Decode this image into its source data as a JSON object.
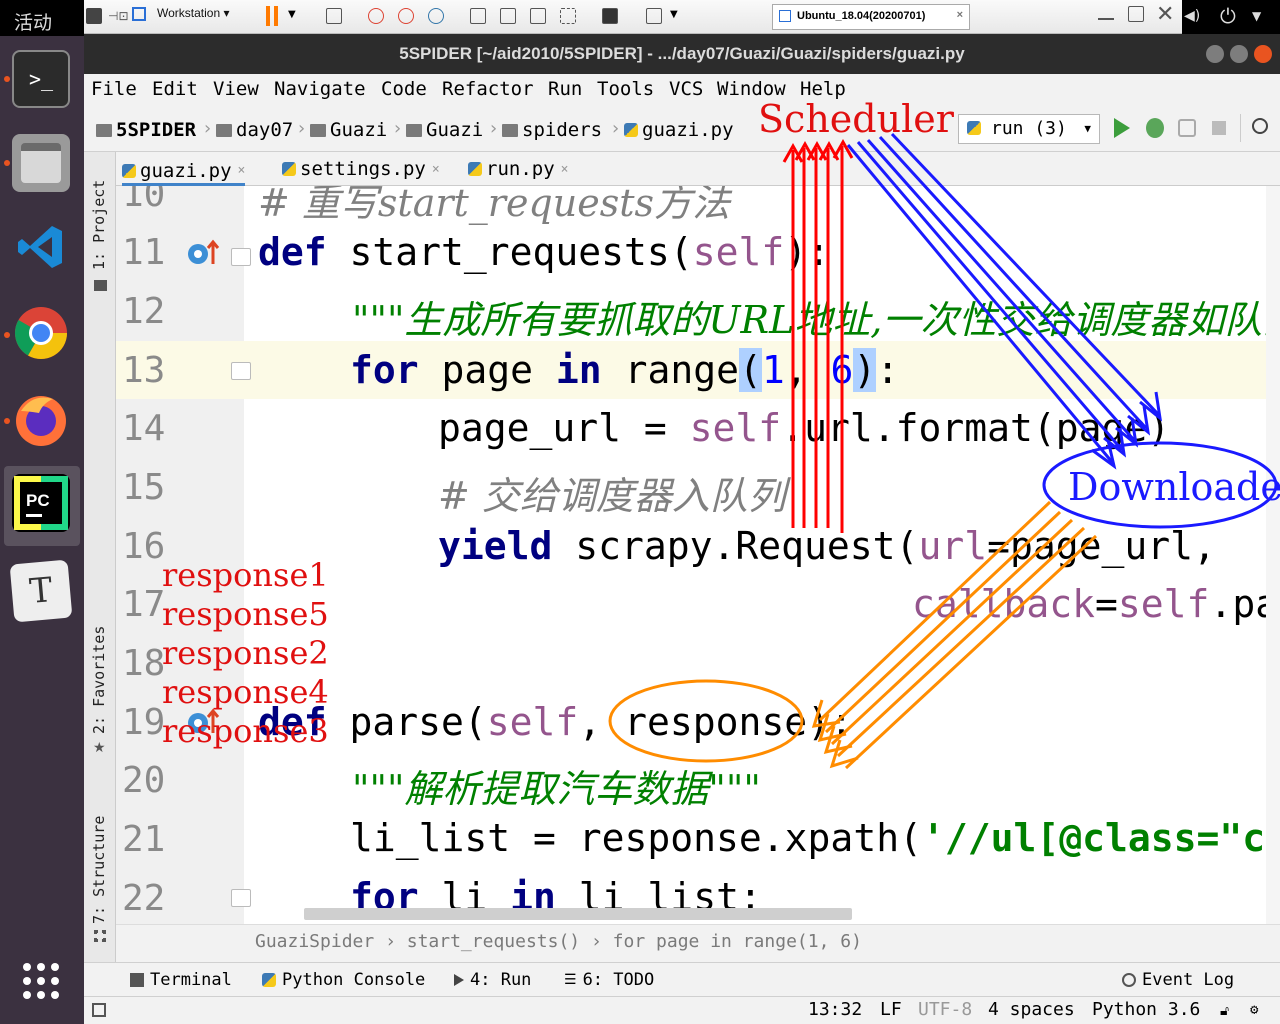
{
  "dock": {
    "activities_label": "活动",
    "apps": [
      "terminal-icon",
      "files-icon",
      "vscode-icon",
      "chrome-icon",
      "firefox-icon",
      "pycharm-icon",
      "typora-icon"
    ],
    "grid_icon": "app-grid-icon"
  },
  "vmware": {
    "workstation_label": "Workstation",
    "vm_tab_label": "Ubuntu_18.04(20200701)"
  },
  "window": {
    "title": "5SPIDER [~/aid2010/5SPIDER] - .../day07/Guazi/Guazi/spiders/guazi.py"
  },
  "menu": [
    "File",
    "Edit",
    "View",
    "Navigate",
    "Code",
    "Refactor",
    "Run",
    "Tools",
    "VCS",
    "Window",
    "Help"
  ],
  "breadcrumb": [
    "5SPIDER",
    "day07",
    "Guazi",
    "Guazi",
    "spiders",
    "guazi.py"
  ],
  "run_config": "run (3)",
  "toolstrip": {
    "project": "1: Project",
    "favorites": "2: Favorites",
    "structure": "7: Structure"
  },
  "tabs": [
    "guazi.py",
    "settings.py",
    "run.py"
  ],
  "editor": {
    "line_numbers": [
      "10",
      "11",
      "12",
      "13",
      "14",
      "15",
      "16",
      "17",
      "18",
      "19",
      "20",
      "21",
      "22"
    ],
    "line10_comment": "# 重写start_requests方法",
    "line11_def": "def",
    "line11_rest": " start_requests(",
    "line11_self": "self",
    "line11_end": "):",
    "line12_doc": "\"\"\"生成所有要抓取的URL地址,一次性交给调度器如队列",
    "line13_for": "for",
    "line13_a": " page ",
    "line13_in": "in",
    "line13_b": " range",
    "line13_p1": "(",
    "line13_n1": "1",
    "line13_c": ", ",
    "line13_n2": "6",
    "line13_p2": ")",
    "line13_end": ":",
    "line14_a": "page_url = ",
    "line14_self": "self",
    "line14_b": ".url.format(page)",
    "line15_comment": "# 交给调度器入队列",
    "line16_yield": "yield",
    "line16_rest": " scrapy.Request(",
    "line16_arg": "url",
    "line16_end": "=page_url,",
    "line17_arg": "callback",
    "line17_eq": "=",
    "line17_self": "self",
    "line17_end": ".par",
    "line19_def": "def",
    "line19_rest": " parse(",
    "line19_self": "self",
    "line19_end": ", response):",
    "line20_doc": "\"\"\"解析提取汽车数据\"\"\"",
    "line21_a": "li_list = response.xpath(",
    "line21_str": "'//ul[@class=\"car",
    "line22_for": "for",
    "line22_a": " li ",
    "line22_in": "in",
    "line22_b": " li_list:"
  },
  "code_breadcrumb": [
    "GuaziSpider",
    "start_requests()",
    "for page in range(1, 6)"
  ],
  "bottom_tools": [
    "Terminal",
    "Python Console",
    "4: Run",
    "6: TODO",
    "Event Log"
  ],
  "status": {
    "position": "13:32",
    "line_sep": "LF",
    "encoding": "UTF-8",
    "indent": "4 spaces",
    "interpreter": "Python 3.6"
  },
  "annotations": {
    "scheduler": "Scheduler",
    "downloader": "Downloader",
    "responses": [
      "response1",
      "response5",
      "response2",
      "response4",
      "response3"
    ],
    "colors": {
      "red": "#ff0000",
      "blue": "#1a1aff",
      "orange": "#ff8c00"
    }
  }
}
